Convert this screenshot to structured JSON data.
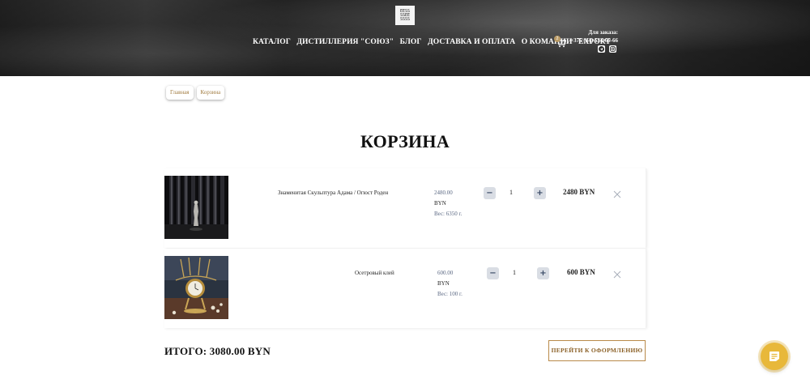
{
  "header": {
    "logo_text": "ЕЕSS\nSSЕЕ\nSSSS",
    "nav": [
      "КАТАЛОГ",
      "ДИСТИЛЛЕРИЯ \"СОЮЗ\"",
      "БЛОГ",
      "ДОСТАВКА И ОПЛАТА",
      "О КОМАНИИ",
      "EXPORT"
    ],
    "cart_count": "2",
    "order_label": "Для заказа:",
    "phone": "+375 (44) 534-66-66",
    "socials": [
      "telegram-icon",
      "instagram-icon"
    ]
  },
  "breadcrumbs": [
    "Главная",
    "Корзина"
  ],
  "page_title": "КОРЗИНА",
  "cart": {
    "items": [
      {
        "name": "Знаменитая Скульптура Адама / Огюст Роден",
        "price": "2480.00",
        "currency": "BYN",
        "weight": "Вес: 6350 г.",
        "quantity": "1",
        "minus": "−",
        "plus": "+",
        "total": "2480 BYN"
      },
      {
        "name": "Осетровый клей",
        "price": "600.00",
        "currency": "BYN",
        "weight": "Вес: 100 г.",
        "quantity": "1",
        "minus": "−",
        "plus": "+",
        "total": "600 BYN"
      }
    ],
    "total_label": "ИТОГО: 3080.00 BYN",
    "checkout_label": "ПЕРЕЙТИ К ОФОРМЛЕНИЮ"
  },
  "colors": {
    "accent": "#b98a4a",
    "badge": "#b99a65",
    "chat_fab": "#e8b83a",
    "price_muted": "#5d6a84"
  }
}
